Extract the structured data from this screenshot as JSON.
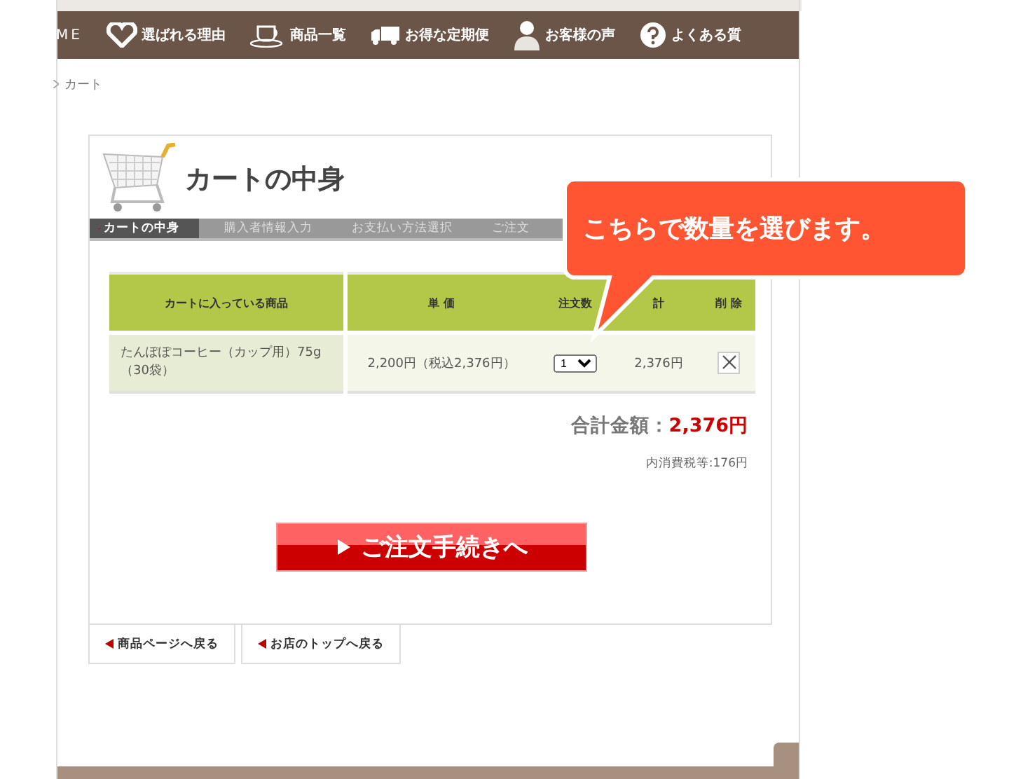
{
  "nav": [
    {
      "label": "ME"
    },
    {
      "label": "選ばれる理由"
    },
    {
      "label": "商品一覧"
    },
    {
      "label": "お得な定期便"
    },
    {
      "label": "お客様の声"
    },
    {
      "label": "よくある質"
    }
  ],
  "breadcrumb": "カート",
  "cart": {
    "title": "カートの中身",
    "steps": [
      {
        "label": "カートの中身",
        "selected": true
      },
      {
        "label": "購入者情報入力",
        "selected": false
      },
      {
        "label": "お支払い方法選択",
        "selected": false
      },
      {
        "label": "ご注文",
        "selected": false
      }
    ],
    "table": {
      "columns": [
        "カートに入っている商品",
        "単 価",
        "注文数",
        "計",
        "削 除"
      ],
      "rows": [
        {
          "product": "たんぽぽコーヒー（カップ用）75g（30袋）",
          "price": "2,200円（税込2,376円）",
          "quantity": "1",
          "subtotal": "2,376円"
        }
      ]
    },
    "total_label": "合計金額：",
    "total": "2,376円",
    "tax": "内消費税等:176円",
    "checkout_button": "ご注文手続きへ"
  },
  "back_links": [
    "商品ページへ戻る",
    "お店のトップへ戻る"
  ],
  "callout": "こちらで数量を選びます。"
}
